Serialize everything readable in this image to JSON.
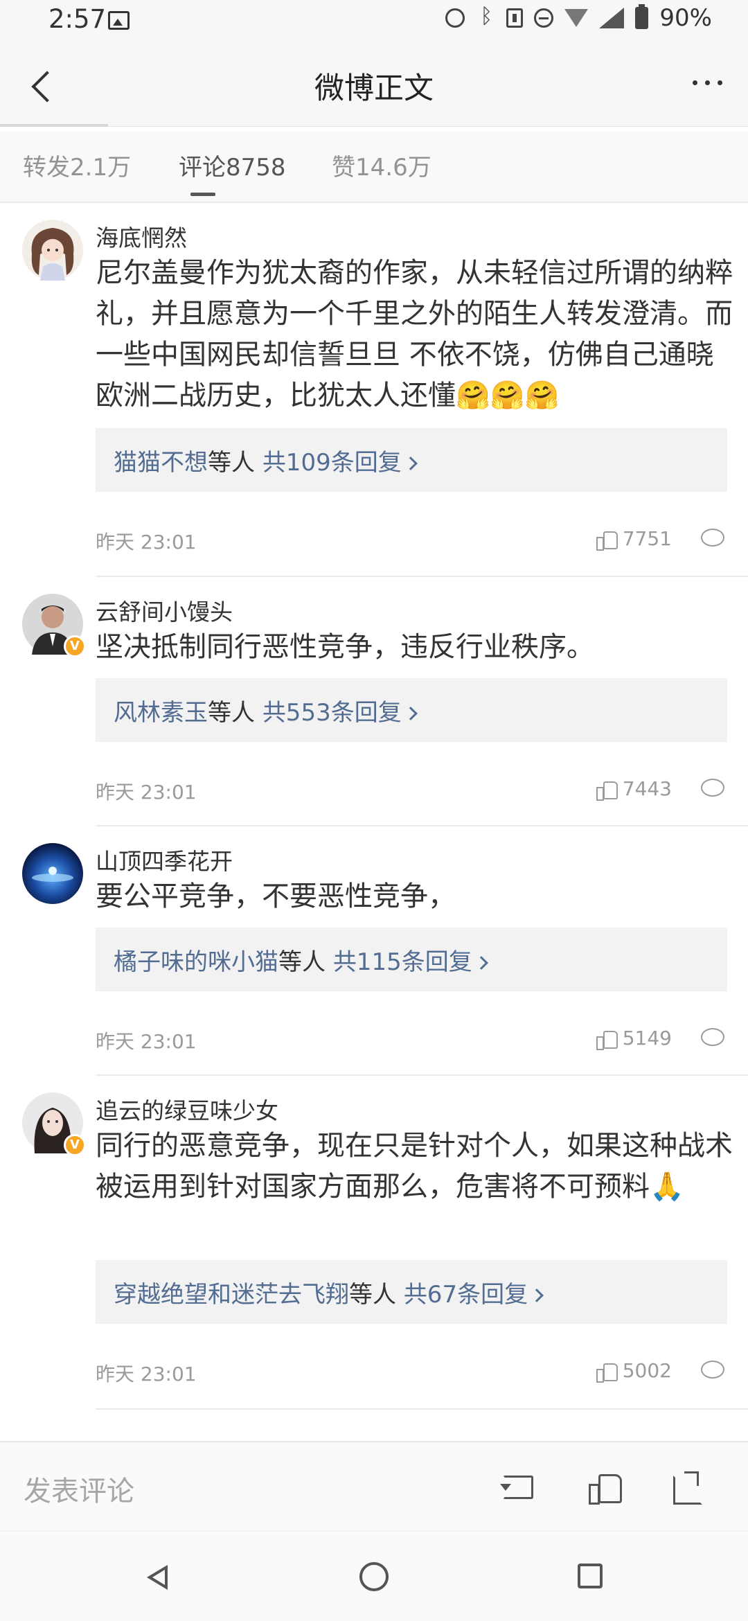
{
  "status_bar": {
    "time": "2:57",
    "battery": "90%"
  },
  "header": {
    "title": "微博正文"
  },
  "tabs": [
    {
      "label": "转发2.1万"
    },
    {
      "label": "评论8758"
    },
    {
      "label": "赞14.6万"
    }
  ],
  "comments": [
    {
      "username": "海底惘然",
      "text": "尼尔盖曼作为犹太裔的作家，从未轻信过所谓的纳粹礼，并且愿意为一个千里之外的陌生人转发澄清。而一些中国网民却信誓旦旦 不依不饶，仿佛自己通晓欧洲二战历史，比犹太人还懂🤗🤗🤗",
      "reply_name": "猫猫不想",
      "reply_mid": "等人 ",
      "reply_count": "共109条回复",
      "time": "昨天 23:01",
      "likes": "7751"
    },
    {
      "username": "云舒间小馒头",
      "text": "坚决抵制同行恶性竞争，违反行业秩序。",
      "reply_name": "风林素玉",
      "reply_mid": "等人 ",
      "reply_count": "共553条回复",
      "time": "昨天 23:01",
      "likes": "7443"
    },
    {
      "username": "山顶四季花开",
      "text": "要公平竞争，不要恶性竞争，",
      "reply_name": "橘子味的咪小猫",
      "reply_mid": "等人 ",
      "reply_count": "共115条回复",
      "time": "昨天 23:01",
      "likes": "5149"
    },
    {
      "username": "追云的绿豆味少女",
      "text": "同行的恶意竞争，现在只是针对个人，如果这种战术被运用到针对国家方面那么，危害将不可预料🙏",
      "reply_name": "穿越绝望和迷茫去飞翔",
      "reply_mid": "等人 ",
      "reply_count": "共67条回复",
      "time": "昨天 23:01",
      "likes": "5002"
    }
  ],
  "bottom_bar": {
    "input_placeholder": "发表评论"
  },
  "colors": {
    "link": "#526c92",
    "verified_badge": "#f5a623"
  }
}
